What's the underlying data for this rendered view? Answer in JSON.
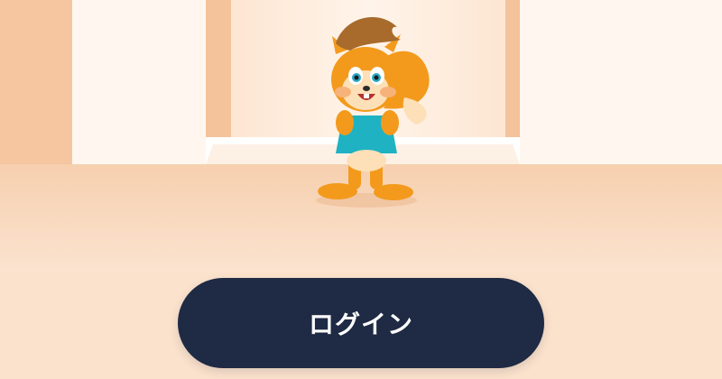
{
  "login_button": {
    "label": "ログイン"
  },
  "colors": {
    "background": "#fbe2cc",
    "floor": "#f7d2b4",
    "wall_light": "#fff7ef",
    "wall_pillar": "#f4c29b",
    "button": "#1f2a44",
    "button_text": "#ffffff",
    "squirrel_fur": "#f39a1c",
    "squirrel_shirt": "#1fb2c2"
  },
  "illustration": {
    "subject": "squirrel-mascot-icon"
  }
}
